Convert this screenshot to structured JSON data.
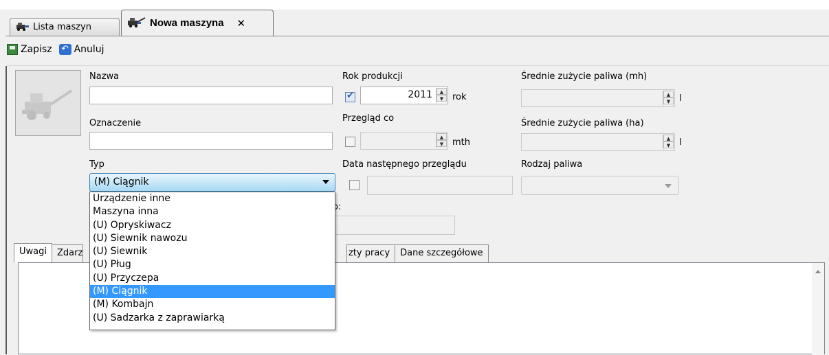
{
  "tabs": [
    {
      "label": "Lista maszyn",
      "icon": "machine-icon"
    },
    {
      "label": "Nowa maszyna",
      "icon": "machine-icon",
      "close": "✕"
    }
  ],
  "toolbar": {
    "save_label": "Zapisz",
    "cancel_label": "Anuluj"
  },
  "form": {
    "name_label": "Nazwa",
    "name_value": "",
    "designation_label": "Oznaczenie",
    "designation_value": "",
    "type_label": "Typ",
    "type_value": "(M) Ciągnik",
    "production_year_label": "Rok produkcji",
    "production_year_value": "2011",
    "production_year_unit": "rok",
    "production_year_checked": true,
    "inspection_label": "Przegląd co",
    "inspection_value": "",
    "inspection_unit": "mth",
    "inspection_checked": false,
    "next_inspection_label": "Data następnego przeglądu",
    "next_inspection_checked": false,
    "fuel_mh_label": "Średnie zużycie paliwa (mh)",
    "fuel_mh_unit": "l",
    "fuel_ha_label": "Średnie zużycie paliwa (ha)",
    "fuel_ha_unit": "l",
    "fuel_type_label": "Rodzaj paliwa",
    "fuel_type_value": "",
    "partial_label": "o:"
  },
  "type_options": [
    "Urządzenie inne",
    "Maszyna inna",
    "(U) Opryskiwacz",
    "(U) Siewnik nawozu",
    "(U) Siewnik",
    "(U) Pług",
    "(U) Przyczepa",
    "(M) Ciągnik",
    "(M) Kombajn",
    "(U) Sadzarka z zaprawiarką"
  ],
  "selected_option_index": 7,
  "bottom_tabs": [
    "Uwagi",
    "Zdarz",
    "zty pracy",
    "Dane szczegółowe"
  ],
  "notes_text": ""
}
